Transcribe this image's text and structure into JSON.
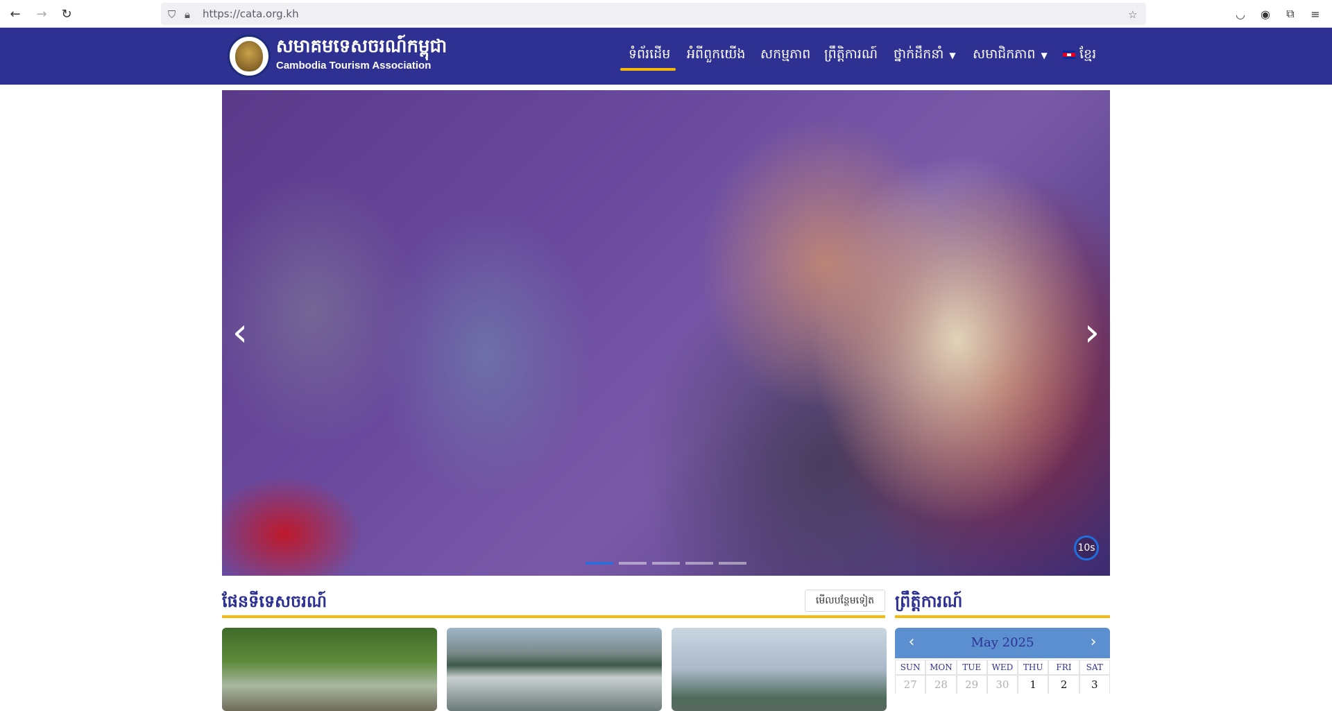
{
  "browser": {
    "url": "https://cata.org.kh"
  },
  "site": {
    "logo_khmer": "សមាគមទេសចរណ៍កម្ពុជា",
    "logo_english": "Cambodia Tourism Association",
    "nav": [
      {
        "label": "ទំព័រដើម",
        "active": true
      },
      {
        "label": "អំពីពួកយើង",
        "active": false
      },
      {
        "label": "សកម្មភាព",
        "active": false
      },
      {
        "label": "ព្រឹត្តិការណ៍",
        "active": false
      },
      {
        "label": "ថ្នាក់ដឹកនាំ",
        "active": false,
        "dropdown": true
      },
      {
        "label": "សមាជិកភាព",
        "active": false,
        "dropdown": true
      },
      {
        "label": "ខ្មែរ",
        "active": false,
        "flag": "cambodia-flag"
      }
    ],
    "accent_color": "#f5b80f",
    "brand_color": "#2e3192"
  },
  "hero": {
    "timer": "10s",
    "slide_count": 5,
    "active_slide": 1
  },
  "sections": {
    "map_title": "ផែនទីទេសចរណ៍",
    "more_label": "មើលបន្ថែមទៀត",
    "events_title": "ព្រឹត្តិការណ៍"
  },
  "calendar": {
    "month": "May 2025",
    "weekdays": [
      "SUN",
      "MON",
      "TUE",
      "WED",
      "THU",
      "FRI",
      "SAT"
    ],
    "first_row": [
      "27",
      "28",
      "29",
      "30",
      "1",
      "2",
      "3"
    ]
  }
}
